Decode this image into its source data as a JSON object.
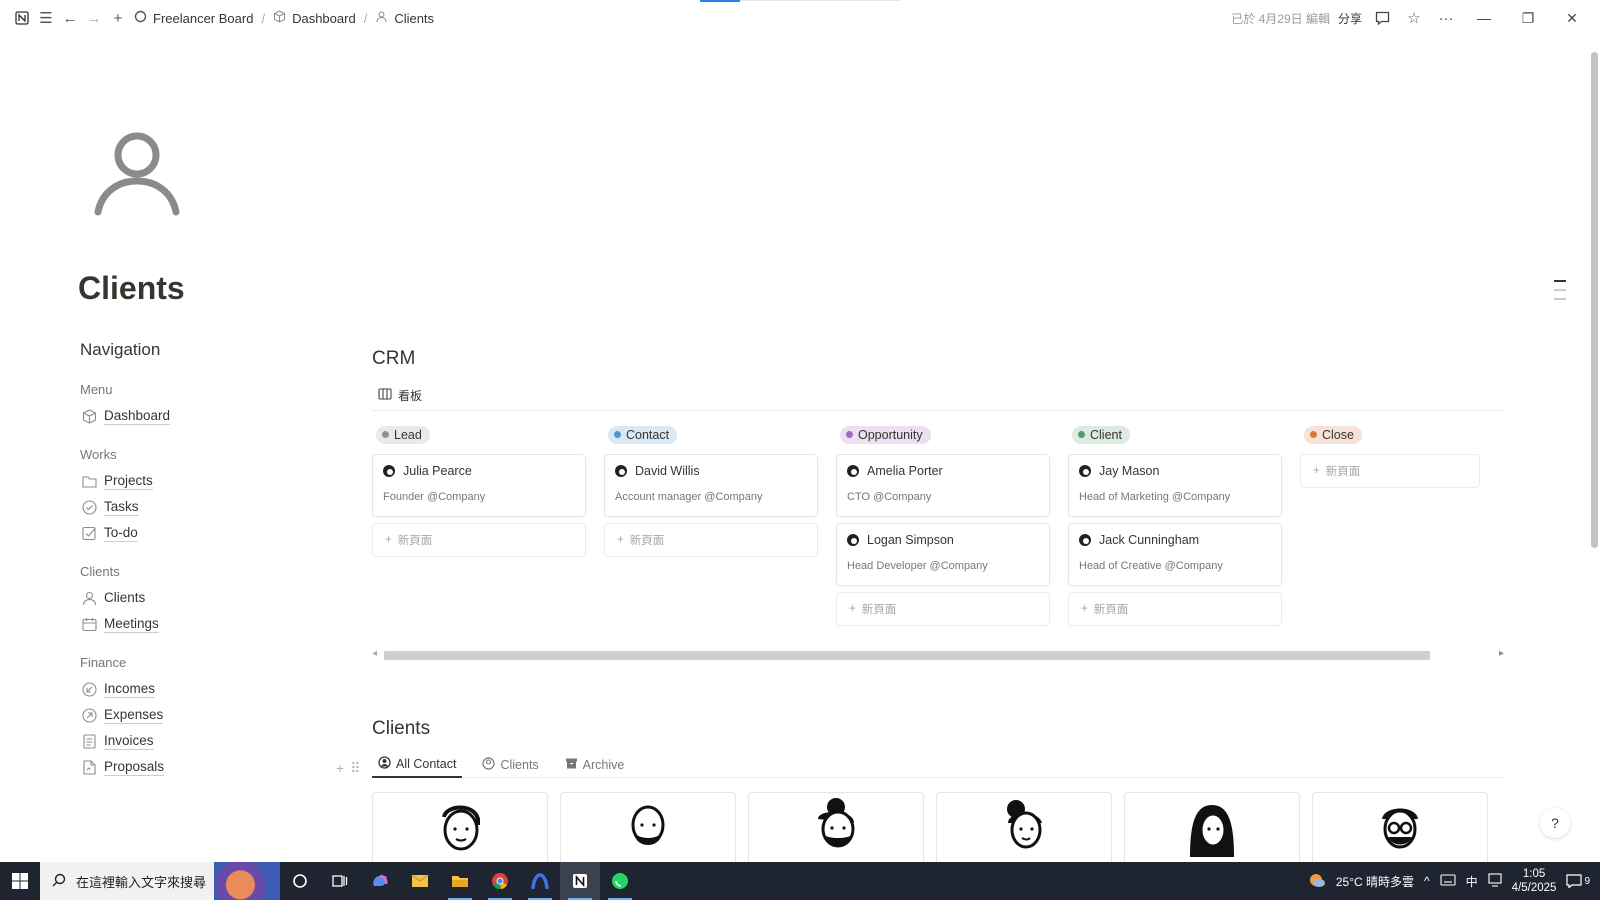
{
  "topbar": {
    "breadcrumbs": [
      {
        "label": "Freelancer Board",
        "icon": "circle-icon"
      },
      {
        "label": "Dashboard",
        "icon": "cube-icon"
      },
      {
        "label": "Clients",
        "icon": "person-icon"
      }
    ],
    "edited": "已於 4月29日 編輯",
    "share": "分享"
  },
  "page": {
    "title": "Clients",
    "icon": "person-icon"
  },
  "nav": {
    "heading": "Navigation",
    "groups": [
      {
        "label": "Menu",
        "items": [
          {
            "label": "Dashboard",
            "icon": "cube-icon"
          }
        ]
      },
      {
        "label": "Works",
        "items": [
          {
            "label": "Projects",
            "icon": "folder-icon"
          },
          {
            "label": "Tasks",
            "icon": "check-circle-icon"
          },
          {
            "label": "To-do",
            "icon": "checkbox-icon"
          }
        ]
      },
      {
        "label": "Clients",
        "items": [
          {
            "label": "Clients",
            "icon": "person-icon"
          },
          {
            "label": "Meetings",
            "icon": "calendar-icon"
          }
        ]
      },
      {
        "label": "Finance",
        "items": [
          {
            "label": "Incomes",
            "icon": "arrow-in-icon"
          },
          {
            "label": "Expenses",
            "icon": "arrow-out-icon"
          },
          {
            "label": "Invoices",
            "icon": "document-icon"
          },
          {
            "label": "Proposals",
            "icon": "proposal-icon"
          }
        ]
      }
    ]
  },
  "crm": {
    "title": "CRM",
    "view_label": "看板",
    "new_page": "新頁面",
    "columns": [
      {
        "label": "Lead",
        "bg": "#e9e9e7",
        "dot": "#91918e",
        "cards": [
          {
            "name": "Julia Pearce",
            "role": "Founder @Company"
          }
        ]
      },
      {
        "label": "Contact",
        "bg": "#d9e9f4",
        "dot": "#4a9ad1",
        "cards": [
          {
            "name": "David Willis",
            "role": "Account manager @Company"
          }
        ]
      },
      {
        "label": "Opportunity",
        "bg": "#eadff3",
        "dot": "#9a6dc4",
        "cards": [
          {
            "name": "Amelia Porter",
            "role": "CTO @Company"
          },
          {
            "name": "Logan Simpson",
            "role": "Head Developer @Company"
          }
        ]
      },
      {
        "label": "Client",
        "bg": "#dcebe2",
        "dot": "#4e9b6e",
        "cards": [
          {
            "name": "Jay Mason",
            "role": "Head of Marketing @Company"
          },
          {
            "name": "Jack Cunningham",
            "role": "Head of Creative @Company"
          }
        ]
      },
      {
        "label": "Close",
        "bg": "#f7e3d6",
        "dot": "#d9773c",
        "cards": []
      }
    ]
  },
  "clients_db": {
    "title": "Clients",
    "tabs": [
      {
        "label": "All Contact",
        "active": true
      },
      {
        "label": "Clients",
        "active": false
      },
      {
        "label": "Archive",
        "active": false
      }
    ]
  },
  "taskbar": {
    "search_placeholder": "在這裡輸入文字來搜尋",
    "weather": "25°C 晴時多雲",
    "ime": "中",
    "time": "1:05",
    "date": "4/5/2025",
    "notifications": "9"
  }
}
